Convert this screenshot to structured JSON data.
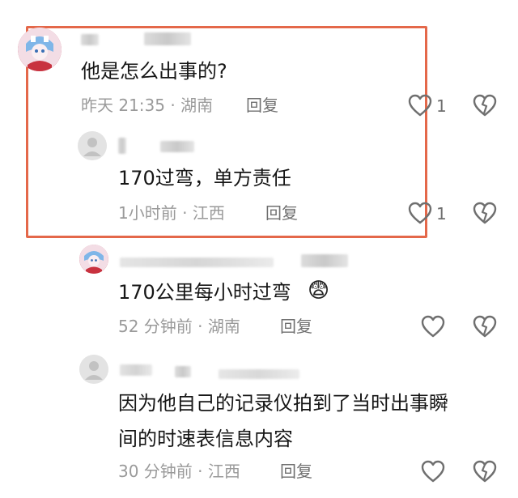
{
  "comments": [
    {
      "text": "他是怎么出事的?",
      "meta": "昨天 21:35 · 湖南",
      "reply_label": "回复",
      "like_count": "1",
      "avatar_icon": "anime-avatar-icon",
      "replies": [
        {
          "text": "170过弯，单方责任",
          "meta": "1小时前 · 江西",
          "reply_label": "回复",
          "like_count": "1",
          "avatar_icon": "default-avatar-icon"
        }
      ]
    },
    {
      "text": "170公里每小时过弯",
      "emoji": "😨",
      "meta": "52 分钟前 · 湖南",
      "reply_label": "回复",
      "avatar_icon": "anime-avatar-icon"
    },
    {
      "text_line1": "因为他自己的记录仪拍到了当时出事瞬",
      "text_line2": "间的时速表信息内容",
      "meta": "30 分钟前 · 江西",
      "reply_label": "回复",
      "avatar_icon": "default-avatar-icon"
    }
  ],
  "colors": {
    "highlight_border": "#e4684a",
    "meta_text": "#9a9a9a",
    "main_text": "#161616"
  }
}
